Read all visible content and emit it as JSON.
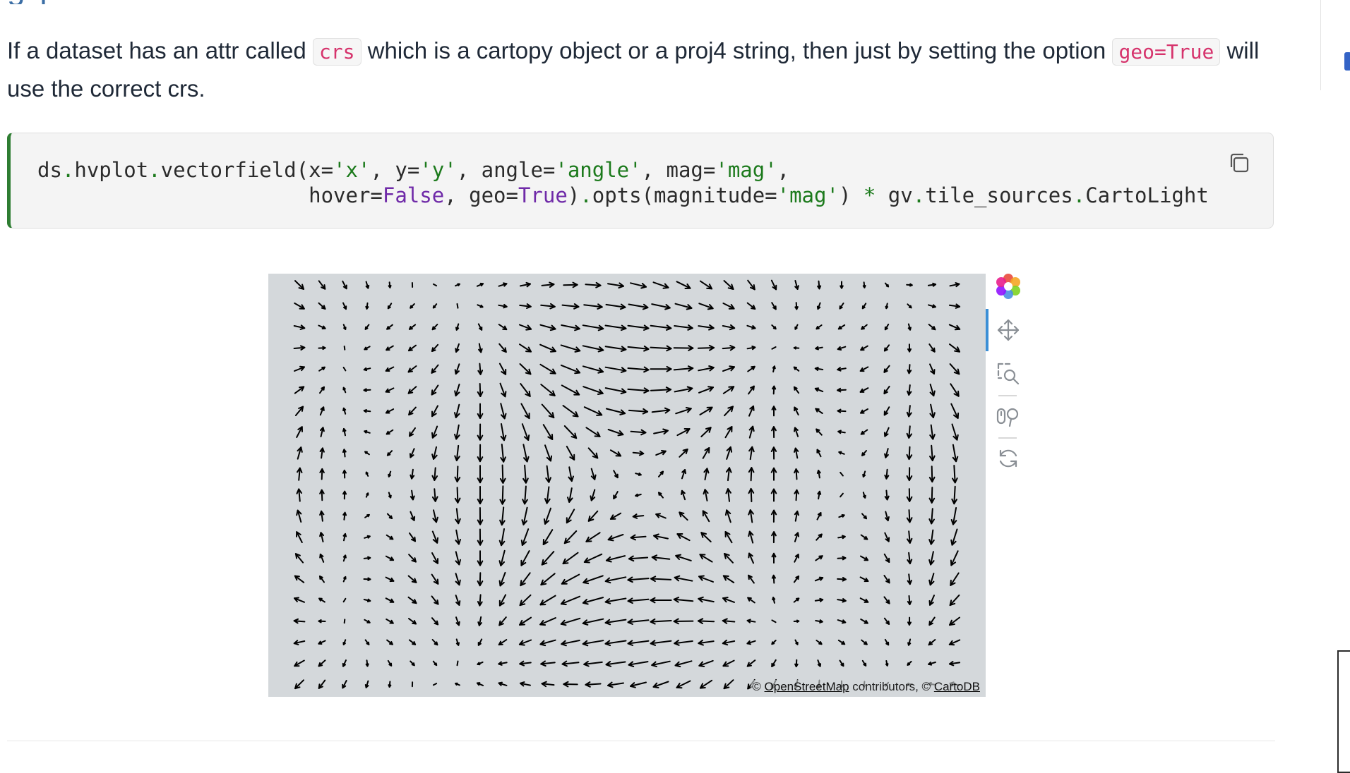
{
  "page": {
    "heading_fragment": "g p",
    "paragraph": {
      "part1": "If a dataset has an attr called ",
      "code1": "crs",
      "part2": " which is a cartopy object or a proj4 string, then just by setting the option ",
      "code2": "geo=True",
      "part3": " will use the correct crs."
    }
  },
  "code_block": {
    "language": "python",
    "lines": [
      "ds.hvplot.vectorfield(x='x', y='y', angle='angle', mag='mag',",
      "                      hover=False, geo=True).opts(magnitude='mag') * gv.tile_sources.CartoLight"
    ],
    "copy_icon": "copy-icon"
  },
  "plot": {
    "type": "vectorfield",
    "background_color": "#d4d8db",
    "arrow_color": "#000000",
    "grid": {
      "columns": 30,
      "rows": 20
    },
    "attribution": {
      "prefix": "© ",
      "link1": "OpenStreetMap",
      "middle": " contributors, © ",
      "link2": "CartoDB"
    }
  },
  "toolbar": {
    "tools": [
      {
        "name": "bokeh-logo-icon",
        "active": false
      },
      {
        "name": "pan-icon",
        "active": true
      },
      {
        "name": "box-zoom-icon",
        "active": false
      },
      {
        "name": "wheel-zoom-icon",
        "active": false
      },
      {
        "name": "reset-icon",
        "active": false
      }
    ]
  }
}
